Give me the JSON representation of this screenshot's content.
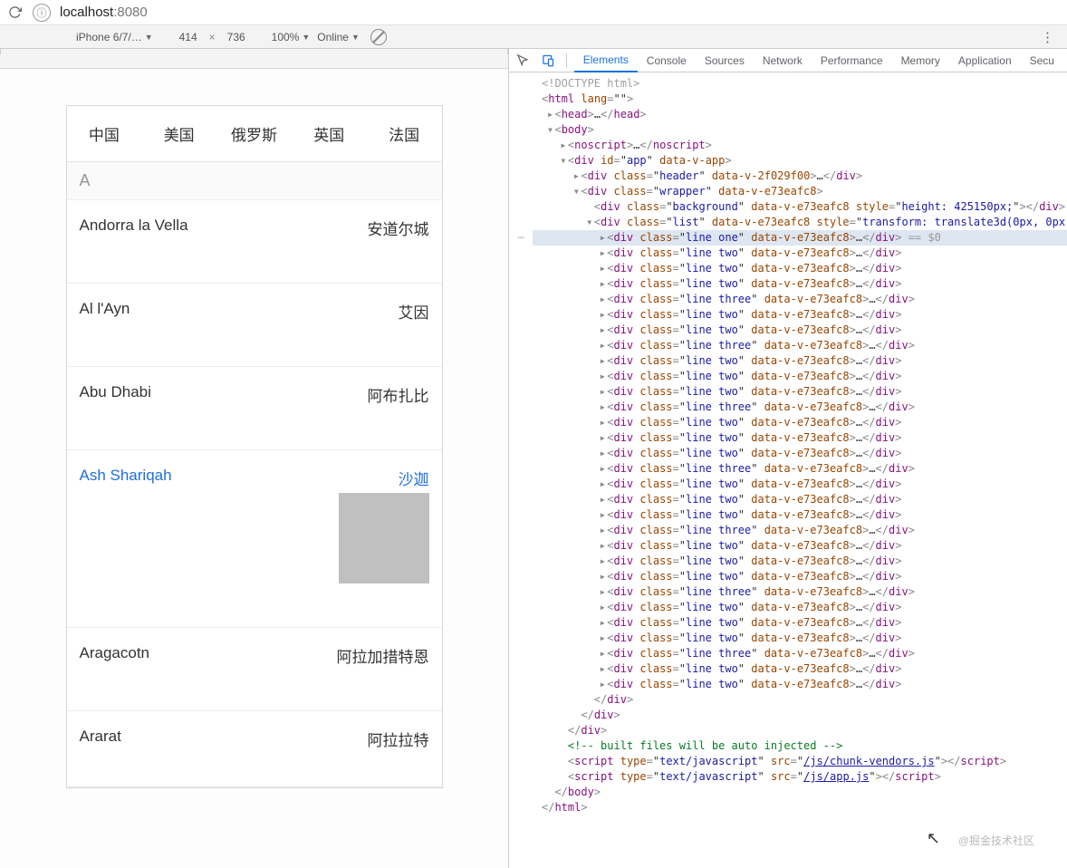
{
  "browser": {
    "url_host": "localhost",
    "url_port": ":8080"
  },
  "device_bar": {
    "device": "iPhone 6/7/…",
    "width": "414",
    "height": "736",
    "zoom": "100%",
    "network": "Online"
  },
  "devtools_tabs": [
    "Elements",
    "Console",
    "Sources",
    "Network",
    "Performance",
    "Memory",
    "Application",
    "Secu"
  ],
  "app": {
    "tabs": [
      "中国",
      "美国",
      "俄罗斯",
      "英国",
      "法国"
    ],
    "section_letter": "A",
    "rows": [
      {
        "en": "Andorra la Vella",
        "cn": "安道尔城"
      },
      {
        "en": "Al l'Ayn",
        "cn": "艾因"
      },
      {
        "en": "Abu Dhabi",
        "cn": "阿布扎比"
      },
      {
        "en": "Ash Shariqah",
        "cn": "沙迦",
        "selected": true,
        "thumb": true
      },
      {
        "en": "Aragacotn",
        "cn": "阿拉加措特恩"
      },
      {
        "en": "Ararat",
        "cn": "阿拉拉特"
      }
    ]
  },
  "dom_lines": [
    {
      "i": 0,
      "raw": "<!DOCTYPE html>",
      "doctype": true
    },
    {
      "i": 0,
      "open": "html",
      "attrs": [
        [
          "lang",
          ""
        ]
      ],
      "inline_close": false
    },
    {
      "i": 1,
      "arrow": "▸",
      "open": "head",
      "ell": true,
      "close": "head"
    },
    {
      "i": 1,
      "arrow": "▾",
      "open": "body"
    },
    {
      "i": 2,
      "arrow": "▸",
      "open": "noscript",
      "ell": true,
      "close": "noscript"
    },
    {
      "i": 2,
      "arrow": "▾",
      "open": "div",
      "attrs": [
        [
          "id",
          "app"
        ],
        [
          "data-v-app",
          ""
        ]
      ]
    },
    {
      "i": 3,
      "arrow": "▸",
      "open": "div",
      "attrs": [
        [
          "class",
          "header"
        ],
        [
          "data-v-2f029f00",
          ""
        ]
      ],
      "ell": true,
      "close": "div"
    },
    {
      "i": 3,
      "arrow": "▾",
      "open": "div",
      "attrs": [
        [
          "class",
          "wrapper"
        ],
        [
          "data-v-e73eafc8",
          ""
        ]
      ]
    },
    {
      "i": 4,
      "open": "div",
      "attrs": [
        [
          "class",
          "background"
        ],
        [
          "data-v-e73eafc8",
          ""
        ],
        [
          "style",
          "height: 425150px;"
        ]
      ],
      "close": "div"
    },
    {
      "i": 4,
      "arrow": "▾",
      "open": "div",
      "attrs": [
        [
          "class",
          "list"
        ],
        [
          "data-v-e73eafc8",
          ""
        ],
        [
          "style",
          "transform: translate3d(0px, 0px, 0px);"
        ]
      ]
    },
    {
      "i": 5,
      "hl": true,
      "gutter": "⋯",
      "arrow": "▸",
      "open": "div",
      "attrs": [
        [
          "class",
          "line one"
        ],
        [
          "data-v-e73eafc8",
          ""
        ]
      ],
      "ell": true,
      "close": "div",
      "eq0": true
    },
    {
      "i": 5,
      "arrow": "▸",
      "open": "div",
      "attrs": [
        [
          "class",
          "line two"
        ],
        [
          "data-v-e73eafc8",
          ""
        ]
      ],
      "ell": true,
      "close": "div"
    },
    {
      "i": 5,
      "arrow": "▸",
      "open": "div",
      "attrs": [
        [
          "class",
          "line two"
        ],
        [
          "data-v-e73eafc8",
          ""
        ]
      ],
      "ell": true,
      "close": "div"
    },
    {
      "i": 5,
      "arrow": "▸",
      "open": "div",
      "attrs": [
        [
          "class",
          "line two"
        ],
        [
          "data-v-e73eafc8",
          ""
        ]
      ],
      "ell": true,
      "close": "div"
    },
    {
      "i": 5,
      "arrow": "▸",
      "open": "div",
      "attrs": [
        [
          "class",
          "line three"
        ],
        [
          "data-v-e73eafc8",
          ""
        ]
      ],
      "ell": true,
      "close": "div"
    },
    {
      "i": 5,
      "arrow": "▸",
      "open": "div",
      "attrs": [
        [
          "class",
          "line two"
        ],
        [
          "data-v-e73eafc8",
          ""
        ]
      ],
      "ell": true,
      "close": "div"
    },
    {
      "i": 5,
      "arrow": "▸",
      "open": "div",
      "attrs": [
        [
          "class",
          "line two"
        ],
        [
          "data-v-e73eafc8",
          ""
        ]
      ],
      "ell": true,
      "close": "div"
    },
    {
      "i": 5,
      "arrow": "▸",
      "open": "div",
      "attrs": [
        [
          "class",
          "line three"
        ],
        [
          "data-v-e73eafc8",
          ""
        ]
      ],
      "ell": true,
      "close": "div"
    },
    {
      "i": 5,
      "arrow": "▸",
      "open": "div",
      "attrs": [
        [
          "class",
          "line two"
        ],
        [
          "data-v-e73eafc8",
          ""
        ]
      ],
      "ell": true,
      "close": "div"
    },
    {
      "i": 5,
      "arrow": "▸",
      "open": "div",
      "attrs": [
        [
          "class",
          "line two"
        ],
        [
          "data-v-e73eafc8",
          ""
        ]
      ],
      "ell": true,
      "close": "div"
    },
    {
      "i": 5,
      "arrow": "▸",
      "open": "div",
      "attrs": [
        [
          "class",
          "line two"
        ],
        [
          "data-v-e73eafc8",
          ""
        ]
      ],
      "ell": true,
      "close": "div"
    },
    {
      "i": 5,
      "arrow": "▸",
      "open": "div",
      "attrs": [
        [
          "class",
          "line three"
        ],
        [
          "data-v-e73eafc8",
          ""
        ]
      ],
      "ell": true,
      "close": "div"
    },
    {
      "i": 5,
      "arrow": "▸",
      "open": "div",
      "attrs": [
        [
          "class",
          "line two"
        ],
        [
          "data-v-e73eafc8",
          ""
        ]
      ],
      "ell": true,
      "close": "div"
    },
    {
      "i": 5,
      "arrow": "▸",
      "open": "div",
      "attrs": [
        [
          "class",
          "line two"
        ],
        [
          "data-v-e73eafc8",
          ""
        ]
      ],
      "ell": true,
      "close": "div"
    },
    {
      "i": 5,
      "arrow": "▸",
      "open": "div",
      "attrs": [
        [
          "class",
          "line two"
        ],
        [
          "data-v-e73eafc8",
          ""
        ]
      ],
      "ell": true,
      "close": "div"
    },
    {
      "i": 5,
      "arrow": "▸",
      "open": "div",
      "attrs": [
        [
          "class",
          "line three"
        ],
        [
          "data-v-e73eafc8",
          ""
        ]
      ],
      "ell": true,
      "close": "div"
    },
    {
      "i": 5,
      "arrow": "▸",
      "open": "div",
      "attrs": [
        [
          "class",
          "line two"
        ],
        [
          "data-v-e73eafc8",
          ""
        ]
      ],
      "ell": true,
      "close": "div"
    },
    {
      "i": 5,
      "arrow": "▸",
      "open": "div",
      "attrs": [
        [
          "class",
          "line two"
        ],
        [
          "data-v-e73eafc8",
          ""
        ]
      ],
      "ell": true,
      "close": "div"
    },
    {
      "i": 5,
      "arrow": "▸",
      "open": "div",
      "attrs": [
        [
          "class",
          "line two"
        ],
        [
          "data-v-e73eafc8",
          ""
        ]
      ],
      "ell": true,
      "close": "div"
    },
    {
      "i": 5,
      "arrow": "▸",
      "open": "div",
      "attrs": [
        [
          "class",
          "line three"
        ],
        [
          "data-v-e73eafc8",
          ""
        ]
      ],
      "ell": true,
      "close": "div"
    },
    {
      "i": 5,
      "arrow": "▸",
      "open": "div",
      "attrs": [
        [
          "class",
          "line two"
        ],
        [
          "data-v-e73eafc8",
          ""
        ]
      ],
      "ell": true,
      "close": "div"
    },
    {
      "i": 5,
      "arrow": "▸",
      "open": "div",
      "attrs": [
        [
          "class",
          "line two"
        ],
        [
          "data-v-e73eafc8",
          ""
        ]
      ],
      "ell": true,
      "close": "div"
    },
    {
      "i": 5,
      "arrow": "▸",
      "open": "div",
      "attrs": [
        [
          "class",
          "line two"
        ],
        [
          "data-v-e73eafc8",
          ""
        ]
      ],
      "ell": true,
      "close": "div"
    },
    {
      "i": 5,
      "arrow": "▸",
      "open": "div",
      "attrs": [
        [
          "class",
          "line three"
        ],
        [
          "data-v-e73eafc8",
          ""
        ]
      ],
      "ell": true,
      "close": "div"
    },
    {
      "i": 5,
      "arrow": "▸",
      "open": "div",
      "attrs": [
        [
          "class",
          "line two"
        ],
        [
          "data-v-e73eafc8",
          ""
        ]
      ],
      "ell": true,
      "close": "div"
    },
    {
      "i": 5,
      "arrow": "▸",
      "open": "div",
      "attrs": [
        [
          "class",
          "line two"
        ],
        [
          "data-v-e73eafc8",
          ""
        ]
      ],
      "ell": true,
      "close": "div"
    },
    {
      "i": 5,
      "arrow": "▸",
      "open": "div",
      "attrs": [
        [
          "class",
          "line two"
        ],
        [
          "data-v-e73eafc8",
          ""
        ]
      ],
      "ell": true,
      "close": "div"
    },
    {
      "i": 5,
      "arrow": "▸",
      "open": "div",
      "attrs": [
        [
          "class",
          "line three"
        ],
        [
          "data-v-e73eafc8",
          ""
        ]
      ],
      "ell": true,
      "close": "div"
    },
    {
      "i": 5,
      "arrow": "▸",
      "open": "div",
      "attrs": [
        [
          "class",
          "line two"
        ],
        [
          "data-v-e73eafc8",
          ""
        ]
      ],
      "ell": true,
      "close": "div"
    },
    {
      "i": 5,
      "arrow": "▸",
      "open": "div",
      "attrs": [
        [
          "class",
          "line two"
        ],
        [
          "data-v-e73eafc8",
          ""
        ]
      ],
      "ell": true,
      "close": "div"
    },
    {
      "i": 4,
      "close_only": "div"
    },
    {
      "i": 3,
      "close_only": "div"
    },
    {
      "i": 2,
      "close_only": "div"
    },
    {
      "i": 2,
      "comment": "built files will be auto injected"
    },
    {
      "i": 2,
      "open": "script",
      "attrs": [
        [
          "type",
          "text/javascript"
        ],
        [
          "src",
          "/js/chunk-vendors.js"
        ]
      ],
      "close": "script",
      "src_link": true
    },
    {
      "i": 2,
      "open": "script",
      "attrs": [
        [
          "type",
          "text/javascript"
        ],
        [
          "src",
          "/js/app.js"
        ]
      ],
      "close": "script",
      "src_link": true
    },
    {
      "i": 1,
      "close_only": "body"
    },
    {
      "i": 0,
      "close_only": "html"
    }
  ],
  "watermark": "@掘金技术社区"
}
